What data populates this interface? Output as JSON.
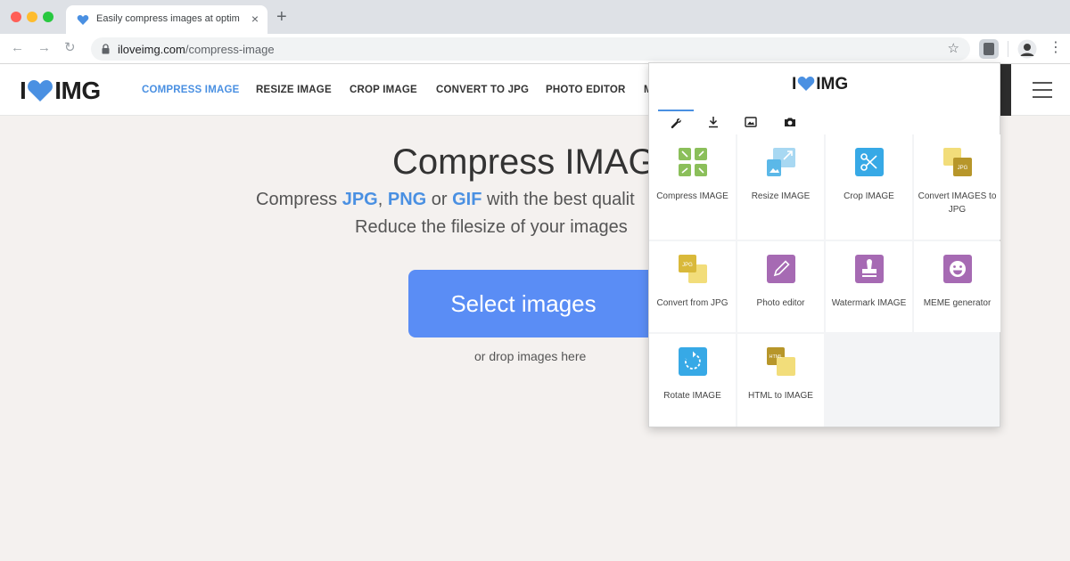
{
  "browser": {
    "tab_title": "Easily compress images at optim",
    "tab_close": "×",
    "new_tab": "+",
    "url_host": "iloveimg.com",
    "url_path": "/compress-image",
    "back": "←",
    "forward": "→",
    "reload": "↻",
    "bookmark": "☆",
    "menu": "⋮"
  },
  "site": {
    "logo_left": "I",
    "logo_right": "IMG",
    "nav": [
      {
        "label": "COMPRESS IMAGE",
        "active": true
      },
      {
        "label": "RESIZE IMAGE"
      },
      {
        "label": "CROP IMAGE"
      },
      {
        "label": "CONVERT TO JPG"
      },
      {
        "label": "PHOTO EDITOR"
      },
      {
        "label": "M"
      }
    ]
  },
  "main": {
    "title": "Compress IMAG",
    "sub1_pre": "Compress ",
    "sub1_jpg": "JPG",
    "sub1_comma": ", ",
    "sub1_png": "PNG",
    "sub1_or": " or ",
    "sub1_gif": "GIF",
    "sub1_post": " with the best qualit",
    "sub2": "Reduce the filesize of your images",
    "select_button": "Select images",
    "drop_hint": "or drop images here"
  },
  "popup": {
    "logo_left": "I",
    "logo_right": "IMG",
    "tabs": [
      "wrench-icon",
      "download-icon",
      "image-icon",
      "camera-icon"
    ],
    "tools": [
      {
        "label": "Compress IMAGE",
        "icon": "compress-icon",
        "color": "#8bbf5a"
      },
      {
        "label": "Resize IMAGE",
        "icon": "resize-icon",
        "color": "#5bb8e8"
      },
      {
        "label": "Crop IMAGE",
        "icon": "crop-icon",
        "color": "#37a9e6"
      },
      {
        "label": "Convert IMAGES to JPG",
        "icon": "convert-to-jpg-icon",
        "color": "#e6c93a"
      },
      {
        "label": "Convert from JPG",
        "icon": "convert-from-jpg-icon",
        "color": "#e6c93a"
      },
      {
        "label": "Photo editor",
        "icon": "photo-editor-icon",
        "color": "#a66ab3"
      },
      {
        "label": "Watermark IMAGE",
        "icon": "watermark-icon",
        "color": "#a66ab3"
      },
      {
        "label": "MEME generator",
        "icon": "meme-icon",
        "color": "#a66ab3"
      },
      {
        "label": "Rotate IMAGE",
        "icon": "rotate-icon",
        "color": "#37a9e6"
      },
      {
        "label": "HTML to IMAGE",
        "icon": "html-to-image-icon",
        "color": "#e6c93a"
      }
    ]
  },
  "colors": {
    "accent_blue": "#4a90e2",
    "button_blue": "#5a8df5",
    "page_bg": "#f4f1ef"
  }
}
